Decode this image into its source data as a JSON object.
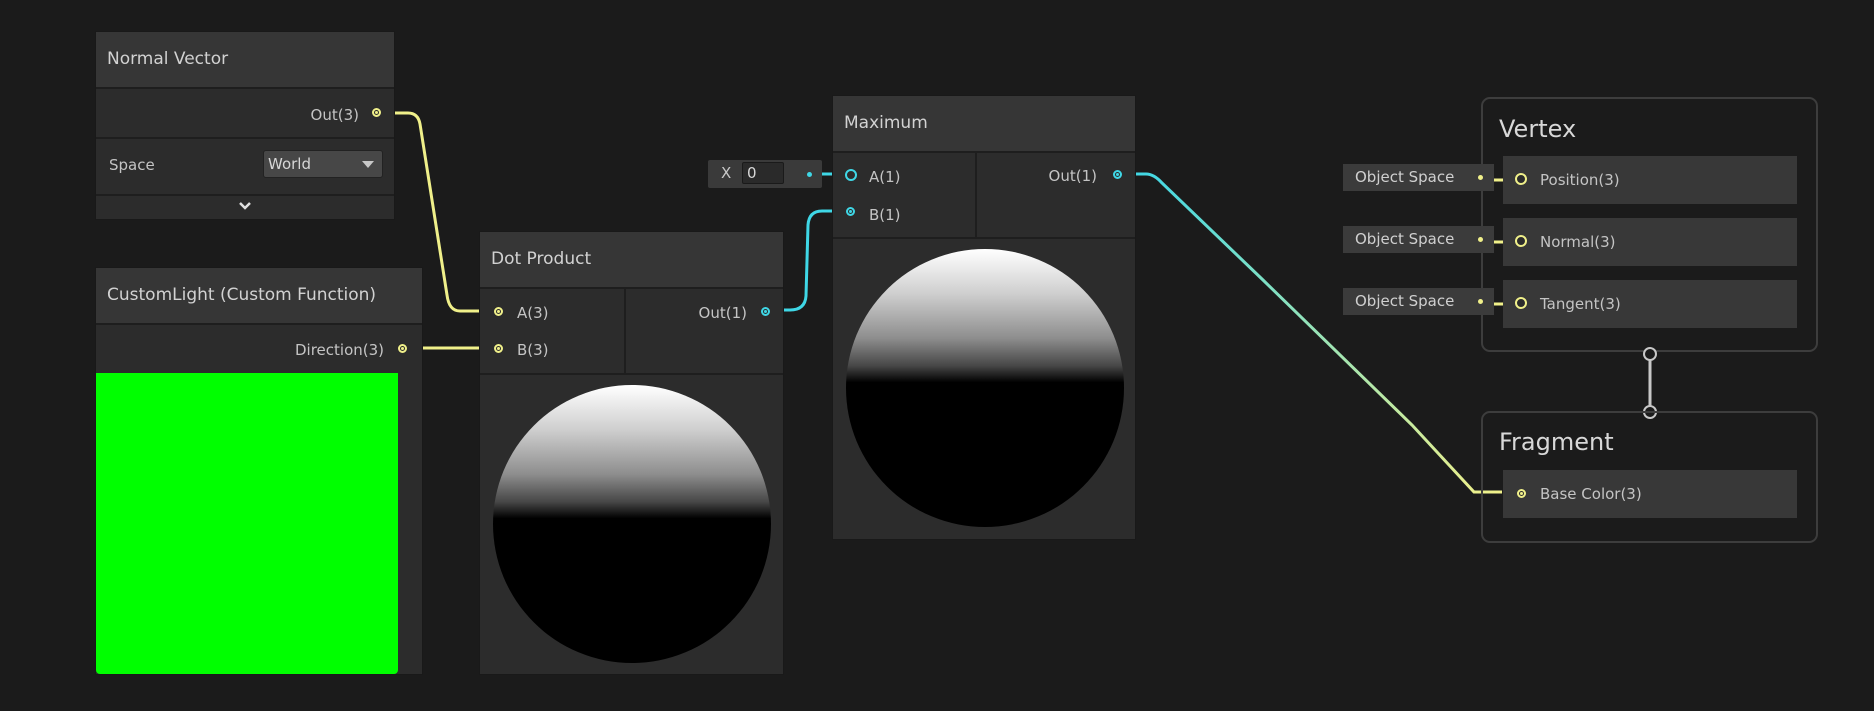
{
  "nodes": {
    "normal_vector": {
      "title": "Normal Vector",
      "out_label": "Out(3)",
      "space_label": "Space",
      "space_value": "World"
    },
    "custom_light": {
      "title": "CustomLight (Custom Function)",
      "out_label": "Direction(3)",
      "preview_color": "#00ff00"
    },
    "dot_product": {
      "title": "Dot Product",
      "input_a": "A(3)",
      "input_b": "B(3)",
      "out_label": "Out(1)"
    },
    "maximum": {
      "title": "Maximum",
      "input_a": "A(1)",
      "input_b": "B(1)",
      "out_label": "Out(1)",
      "inline_x_label": "X",
      "inline_x_value": "0"
    }
  },
  "master_stack": {
    "vertex": {
      "title": "Vertex",
      "blocks": [
        {
          "label": "Position(3)",
          "chip": "Object Space"
        },
        {
          "label": "Normal(3)",
          "chip": "Object Space"
        },
        {
          "label": "Tangent(3)",
          "chip": "Object Space"
        }
      ]
    },
    "fragment": {
      "title": "Fragment",
      "blocks": [
        {
          "label": "Base Color(3)"
        }
      ]
    }
  },
  "colors": {
    "vector3_wire": "#f0f08a",
    "float_wire": "#3fd7e6",
    "background": "#1b1b1b",
    "node_body": "#2c2c2c"
  }
}
